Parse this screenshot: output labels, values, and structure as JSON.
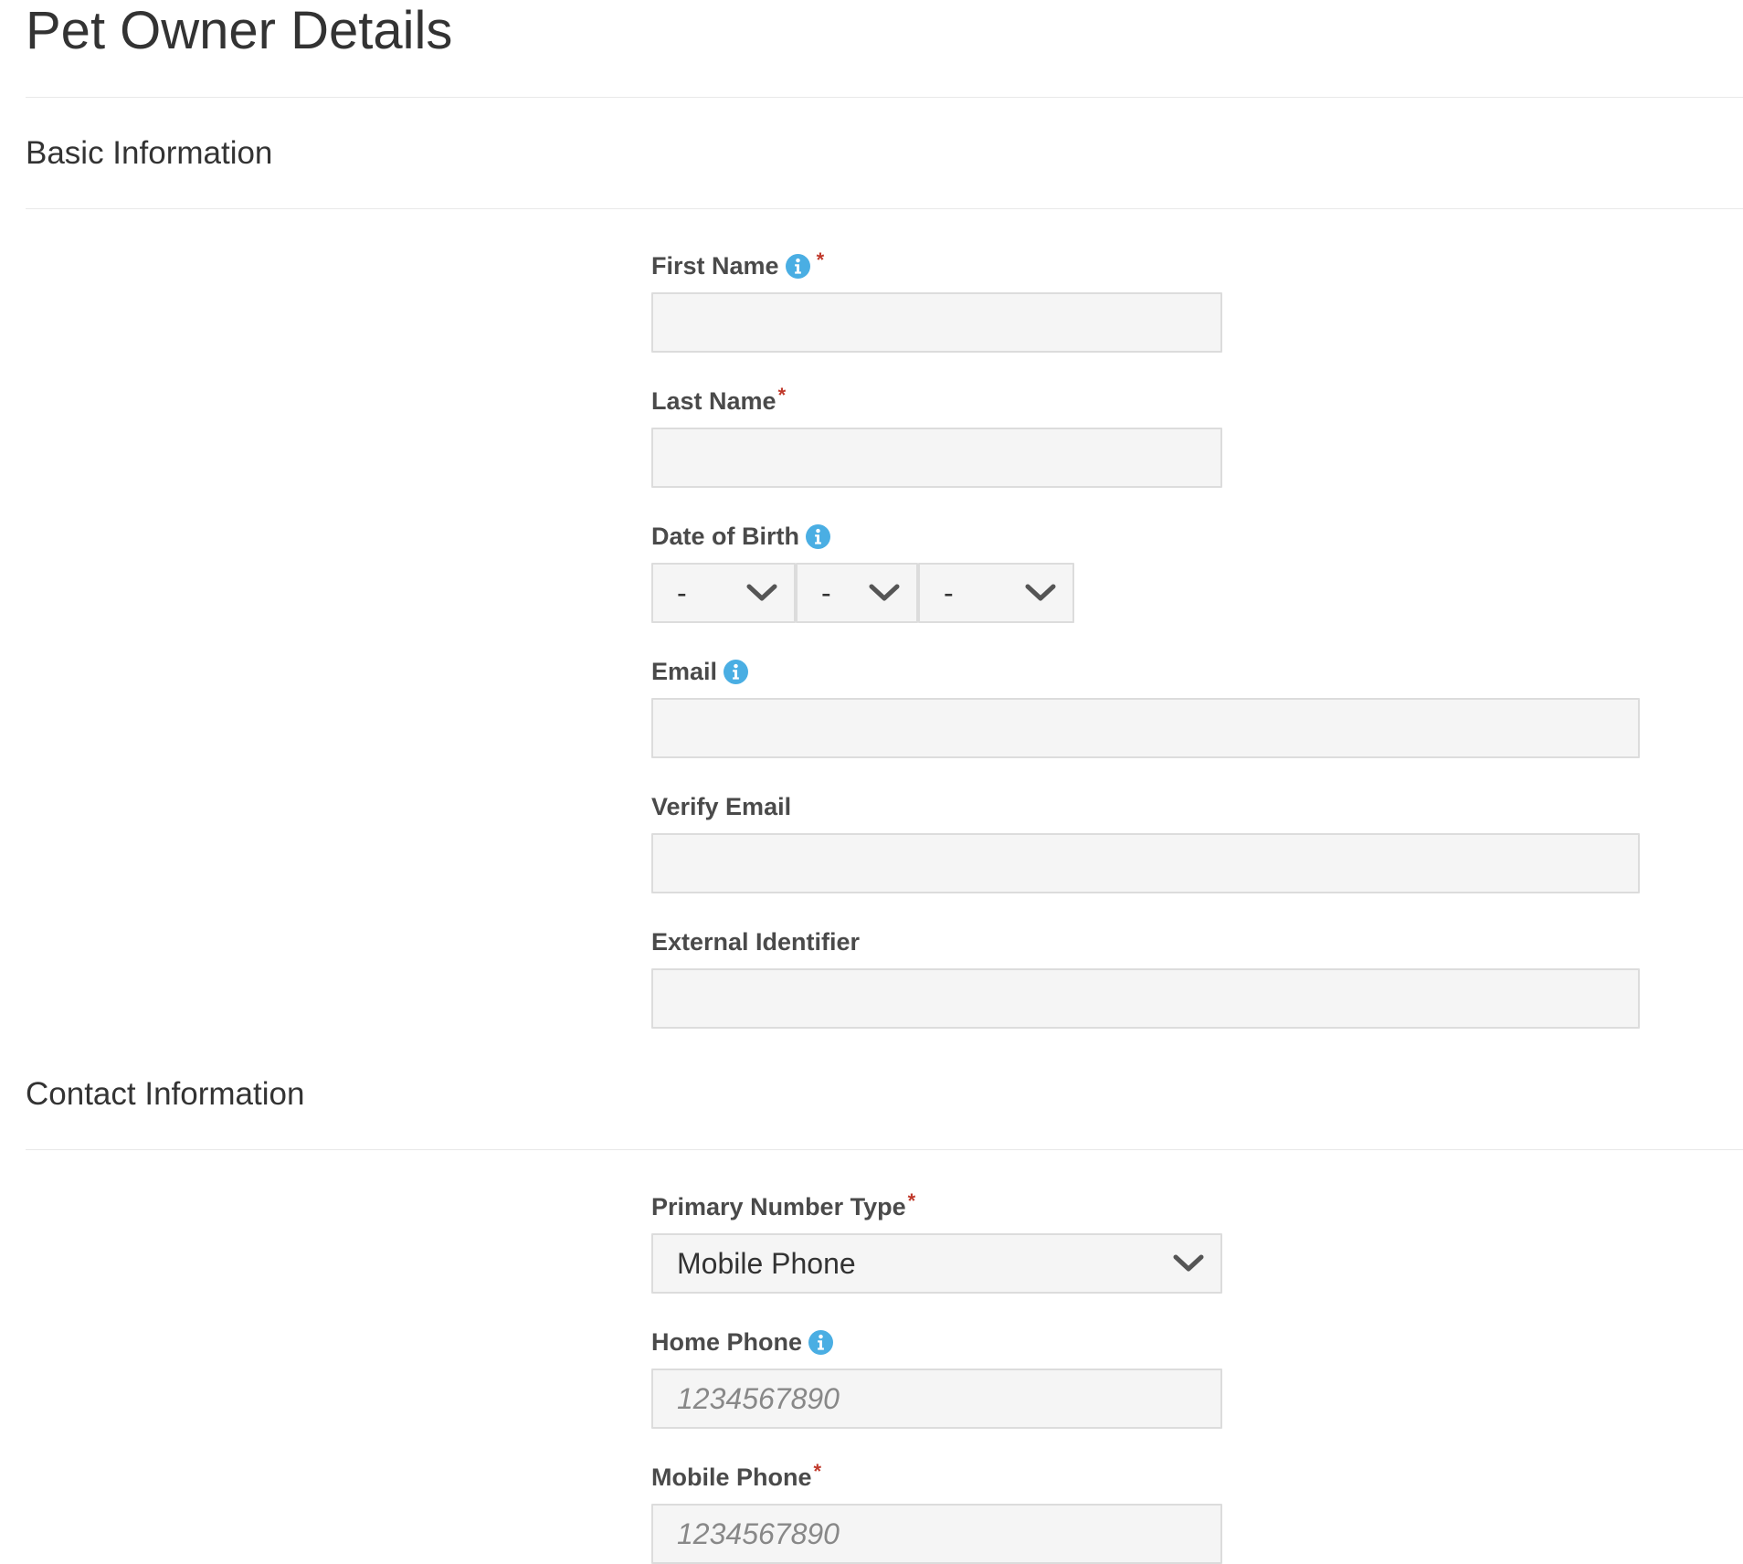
{
  "page": {
    "title": "Pet Owner Details"
  },
  "sections": {
    "basic": {
      "title": "Basic Information",
      "first_name": {
        "label": "First Name",
        "required_mark": "*",
        "value": ""
      },
      "last_name": {
        "label": "Last Name",
        "required_mark": "*",
        "value": ""
      },
      "date_of_birth": {
        "label": "Date of Birth",
        "month": "-",
        "day": "-",
        "year": "-"
      },
      "email": {
        "label": "Email",
        "value": ""
      },
      "verify_email": {
        "label": "Verify Email",
        "value": ""
      },
      "external_identifier": {
        "label": "External Identifier",
        "value": ""
      }
    },
    "contact": {
      "title": "Contact Information",
      "primary_number_type": {
        "label": "Primary Number Type",
        "required_mark": "*",
        "selected": "Mobile Phone"
      },
      "home_phone": {
        "label": "Home Phone",
        "placeholder": "1234567890"
      },
      "mobile_phone": {
        "label": "Mobile Phone",
        "required_mark": "*",
        "placeholder": "1234567890"
      }
    }
  },
  "icons": {
    "info": "info-circle-icon",
    "dropdown": "chevron-down-icon"
  },
  "colors": {
    "info_icon": "#4aaee3",
    "required_mark": "#c0392b",
    "input_background": "#f5f5f5",
    "input_border": "#dcdcdc"
  }
}
